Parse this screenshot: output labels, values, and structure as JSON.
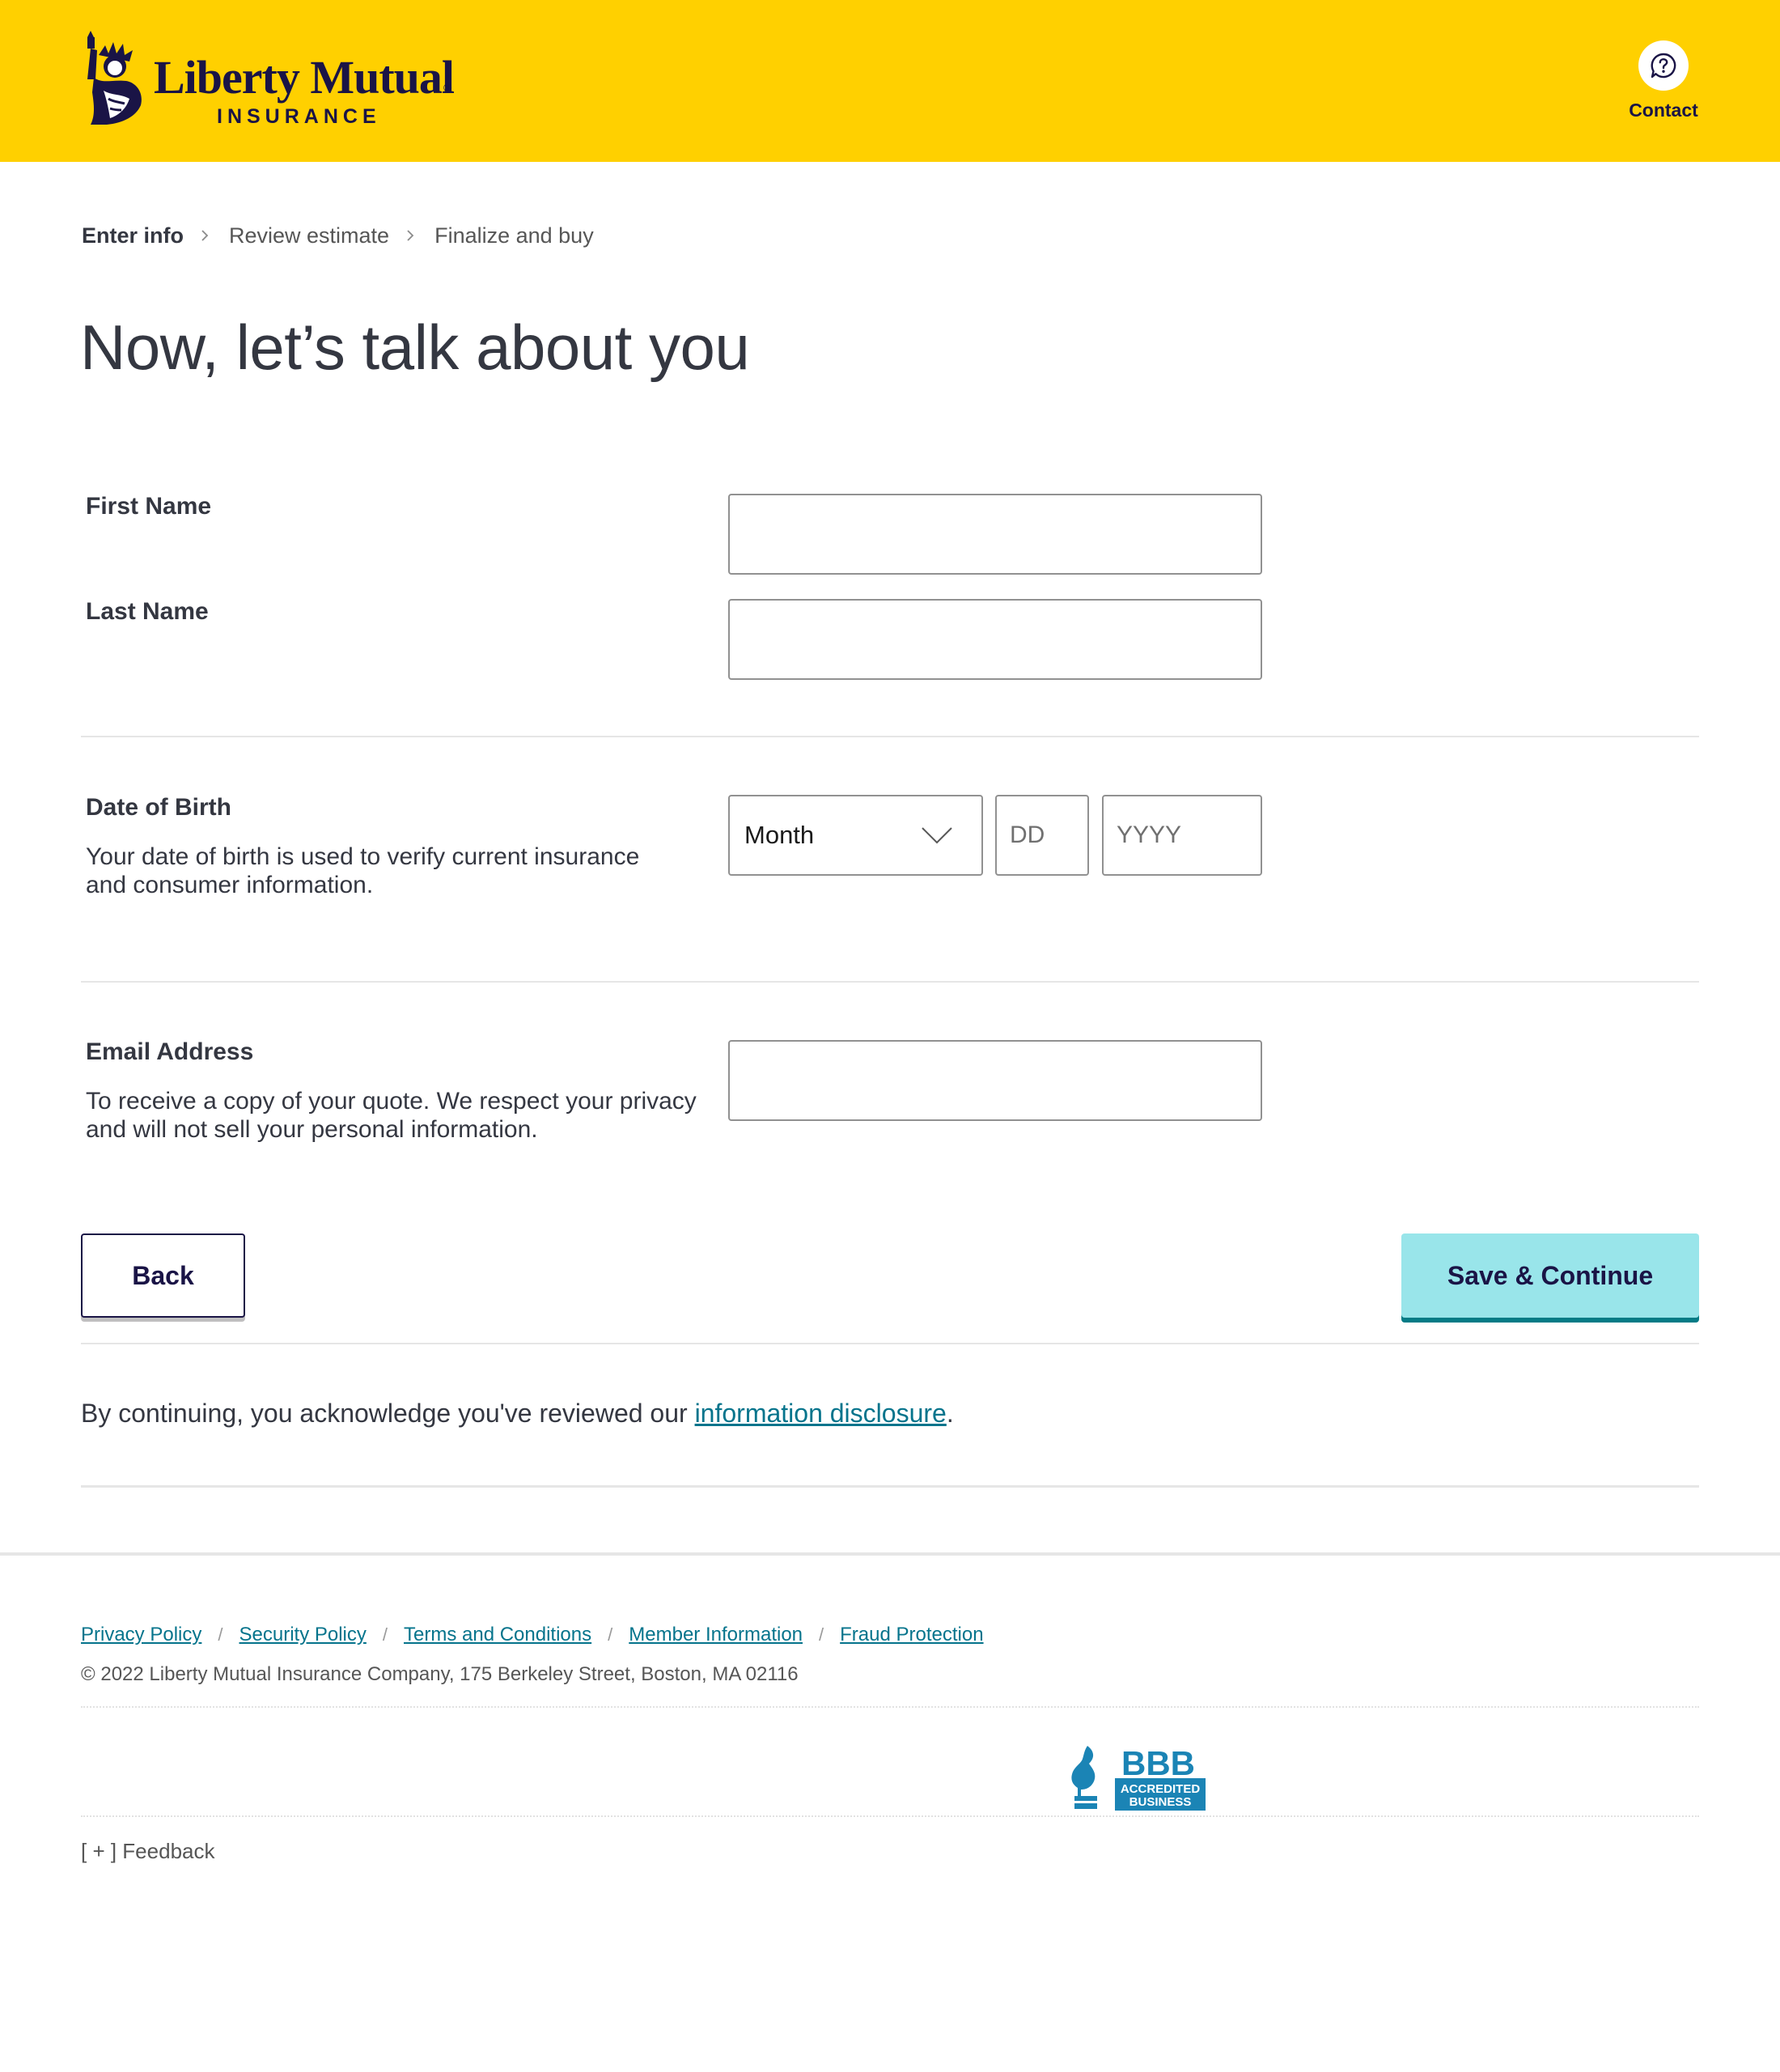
{
  "header": {
    "brand_name": "Liberty Mutual",
    "brand_reg": "®",
    "brand_sub": "INSURANCE",
    "contact_label": "Contact",
    "contact_icon": "help-bubble-icon"
  },
  "breadcrumb": {
    "steps": [
      {
        "label": "Enter info",
        "active": true
      },
      {
        "label": "Review estimate",
        "active": false
      },
      {
        "label": "Finalize and buy",
        "active": false
      }
    ]
  },
  "page_title": "Now, let’s talk about you",
  "form": {
    "first_name": {
      "label": "First Name",
      "value": ""
    },
    "last_name": {
      "label": "Last Name",
      "value": ""
    },
    "dob": {
      "label": "Date of Birth",
      "helper": "Your date of birth is used to verify current insurance and consumer information.",
      "month_selected": "Month",
      "day_placeholder": "DD",
      "year_placeholder": "YYYY"
    },
    "email": {
      "label": "Email Address",
      "helper": "To receive a copy of your quote. We respect your privacy and will not sell your personal information.",
      "value": ""
    }
  },
  "buttons": {
    "back": "Back",
    "save": "Save & Continue"
  },
  "acknowledgement": {
    "prefix": "By continuing, you acknowledge you've reviewed our ",
    "link": "information disclosure",
    "suffix": "."
  },
  "footer": {
    "links": [
      "Privacy Policy",
      "Security Policy",
      "Terms and Conditions",
      "Member Information",
      "Fraud Protection"
    ],
    "separator": "/",
    "copyright": "© 2022 Liberty Mutual Insurance Company, 175 Berkeley Street, Boston, MA 02116",
    "bbb_text": "BBB",
    "bbb_line1": "ACCREDITED",
    "bbb_line2": "BUSINESS",
    "feedback": "[ + ]  Feedback"
  },
  "colors": {
    "header_bg": "#ffd000",
    "brand_navy": "#1a1446",
    "link_teal": "#06748c",
    "save_bg": "#99e5ea",
    "save_shadow": "#037b86",
    "bbb_blue": "#1b84b5"
  }
}
